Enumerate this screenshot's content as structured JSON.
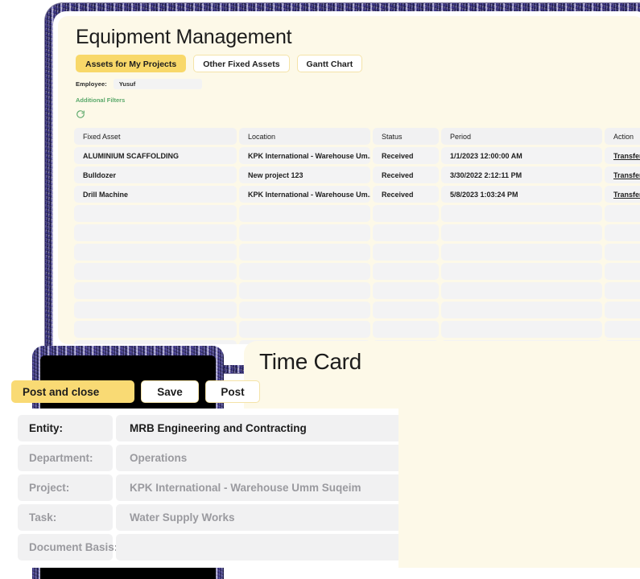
{
  "equipment": {
    "title": "Equipment Management",
    "tabs": [
      {
        "label": "Assets for My Projects",
        "active": true
      },
      {
        "label": "Other Fixed Assets",
        "active": false
      },
      {
        "label": "Gantt Chart",
        "active": false
      }
    ],
    "filter": {
      "employee_label": "Employee:",
      "employee_value": "Yusuf",
      "additional_filters_label": "Additional Filters",
      "refresh_icon": "refresh-icon"
    },
    "table": {
      "columns": [
        "Fixed Asset",
        "Location",
        "Status",
        "Period",
        "Action"
      ],
      "rows": [
        {
          "asset": "ALUMINIUM SCAFFOLDING",
          "location": "KPK International - Warehouse Um...",
          "status": "Received",
          "period": "1/1/2023 12:00:00 AM",
          "action": "Transfer"
        },
        {
          "asset": "Bulldozer",
          "location": "New project 123",
          "status": "Received",
          "period": "3/30/2022 2:12:11 PM",
          "action": "Transfer"
        },
        {
          "asset": "Drill Machine",
          "location": "KPK International - Warehouse Um...",
          "status": "Received",
          "period": "5/8/2023 1:03:24 PM",
          "action": "Transfer"
        }
      ],
      "empty_row_count": 11
    }
  },
  "time_card": {
    "title": "Time Card",
    "buttons": {
      "post_and_close": "Post and close",
      "save": "Save",
      "post": "Post"
    },
    "fields": [
      {
        "label": "Entity:",
        "value": "MRB Engineering and Contracting",
        "emphasis": true
      },
      {
        "label": "Department:",
        "value": "Operations",
        "emphasis": false
      },
      {
        "label": "Project:",
        "value": "KPK International - Warehouse Umm Suqeim",
        "emphasis": false
      },
      {
        "label": "Task:",
        "value": "Water Supply Works",
        "emphasis": false
      },
      {
        "label": "Document Basis:",
        "value": "",
        "emphasis": false
      }
    ]
  },
  "colors": {
    "accent_yellow": "#f8d869",
    "panel_cream": "#fdf9e8",
    "link_green": "#5aa86a",
    "frame_purple": "#4a4682"
  }
}
